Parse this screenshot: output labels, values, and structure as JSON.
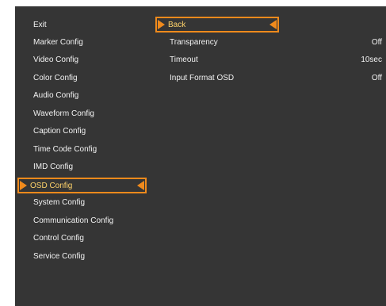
{
  "left_menu": {
    "items": [
      {
        "label": "Exit"
      },
      {
        "label": "Marker Config"
      },
      {
        "label": "Video Config"
      },
      {
        "label": "Color Config"
      },
      {
        "label": "Audio Config"
      },
      {
        "label": "Waveform Config"
      },
      {
        "label": "Caption Config"
      },
      {
        "label": "Time Code Config"
      },
      {
        "label": "IMD Config"
      },
      {
        "label": "OSD Config",
        "selected": true
      },
      {
        "label": "System Config"
      },
      {
        "label": "Communication Config"
      },
      {
        "label": "Control Config"
      },
      {
        "label": "Service Config"
      }
    ]
  },
  "submenu": {
    "items": [
      {
        "label": "Back",
        "value": "",
        "selected": true
      },
      {
        "label": "Transparency",
        "value": "Off"
      },
      {
        "label": "Timeout",
        "value": "10sec"
      },
      {
        "label": "Input Format OSD",
        "value": "Off"
      }
    ]
  },
  "colors": {
    "background": "#353535",
    "text": "#f2f2f2",
    "highlight_border": "#f08a1c",
    "highlight_text": "#ffd36a"
  },
  "icons": {
    "selection_left": "arrow-right-icon",
    "selection_right": "arrow-left-icon"
  }
}
